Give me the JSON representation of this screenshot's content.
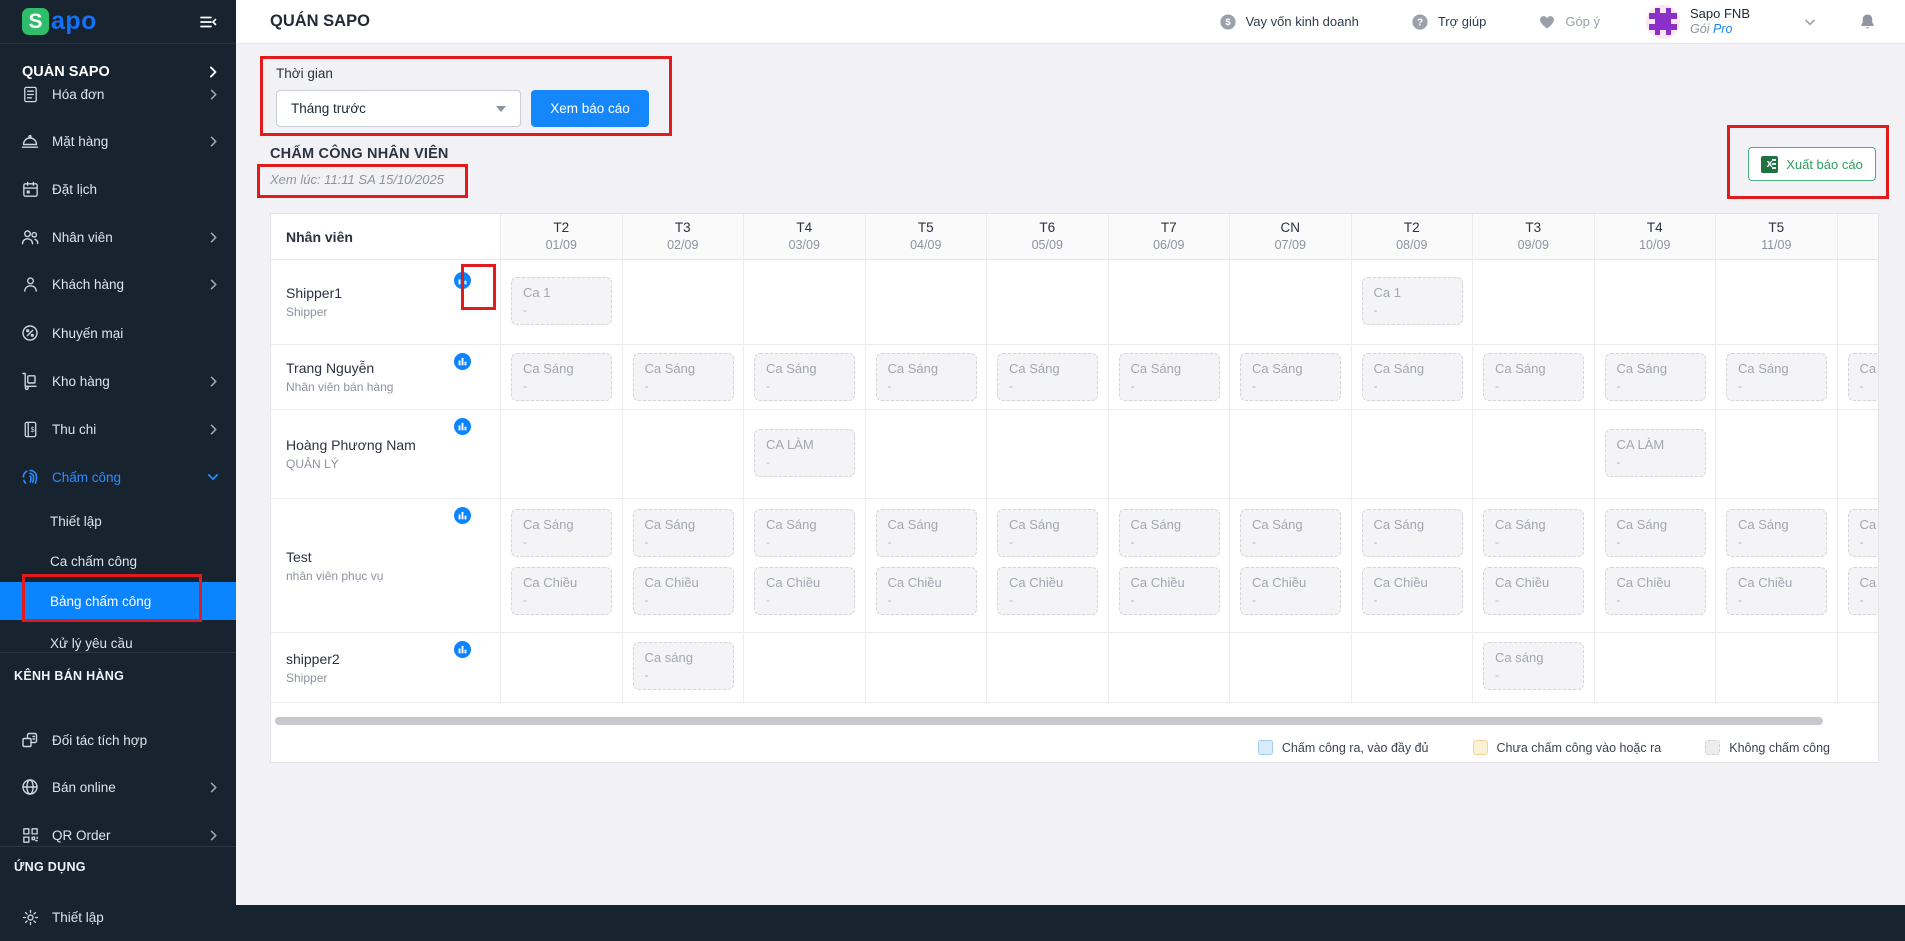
{
  "brand": {
    "logo_s": "S",
    "logo_rest": "apo",
    "colors": {
      "accent_blue": "#1687fa",
      "active_nav_blue": "#0b84ff",
      "logo_green": "#2ebd6b",
      "logo_blue": "#1470f5",
      "annotation_red": "#e11b1b",
      "export_green": "#2f9e5f"
    }
  },
  "topbar": {
    "title": "QUÁN SAPO",
    "links": [
      {
        "icon": "dollar-circle-icon",
        "label": "Vay vốn kinh doanh",
        "muted": false
      },
      {
        "icon": "question-circle-icon",
        "label": "Trợ giúp",
        "muted": false
      },
      {
        "icon": "heart-icon",
        "label": "Góp ý",
        "muted": true
      }
    ],
    "account": {
      "name": "Sapo FNB",
      "plan_label": "Gói",
      "plan_value": "Pro"
    }
  },
  "sidebar": {
    "store_label": "QUÁN SAPO",
    "sections": [
      {
        "header": "",
        "items": [
          {
            "label": "Hóa đơn",
            "icon": "invoice-icon",
            "chevron": "right"
          },
          {
            "label": "Mặt hàng",
            "icon": "dish-icon",
            "chevron": "right"
          },
          {
            "label": "Đặt lịch",
            "icon": "calendar-icon",
            "chevron": ""
          },
          {
            "label": "Nhân viên",
            "icon": "staff-icon",
            "chevron": "right"
          },
          {
            "label": "Khách hàng",
            "icon": "customer-icon",
            "chevron": "right"
          },
          {
            "label": "Khuyến mại",
            "icon": "promo-icon",
            "chevron": ""
          },
          {
            "label": "Kho hàng",
            "icon": "warehouse-icon",
            "chevron": "right"
          },
          {
            "label": "Thu chi",
            "icon": "cashbook-icon",
            "chevron": "right"
          },
          {
            "label": "Chấm công",
            "icon": "fingerprint-icon",
            "chevron": "down",
            "active": true,
            "children": [
              {
                "label": "Thiết lập",
                "active": false
              },
              {
                "label": "Ca chấm công",
                "active": false
              },
              {
                "label": "Bảng chấm công",
                "active": true
              },
              {
                "label": "Xử lý yêu cầu",
                "active": false
              }
            ]
          }
        ]
      },
      {
        "header": "KÊNH BÁN HÀNG",
        "items": [
          {
            "label": "Đối tác tích hợp",
            "icon": "integration-icon",
            "chevron": ""
          },
          {
            "label": "Bán online",
            "icon": "globe-icon",
            "chevron": "right"
          },
          {
            "label": "QR Order",
            "icon": "qr-icon",
            "chevron": "right"
          }
        ]
      },
      {
        "header": "ỨNG DỤNG",
        "items": [
          {
            "label": "Thiết lập",
            "icon": "gear-icon",
            "chevron": ""
          }
        ]
      }
    ]
  },
  "filter": {
    "label": "Thời gian",
    "selected": "Tháng trước",
    "submit_label": "Xem báo cáo"
  },
  "report": {
    "title": "CHẤM CÔNG NHÂN VIÊN",
    "viewed_at": "Xem lúc: 11:11 SA 15/10/2025",
    "export_label": "Xuất báo cáo"
  },
  "table": {
    "staff_header": "Nhân viên",
    "chip_value": "-",
    "columns": [
      {
        "day": "T2",
        "date": "01/09"
      },
      {
        "day": "T3",
        "date": "02/09"
      },
      {
        "day": "T4",
        "date": "03/09"
      },
      {
        "day": "T5",
        "date": "04/09"
      },
      {
        "day": "T6",
        "date": "05/09"
      },
      {
        "day": "T7",
        "date": "06/09"
      },
      {
        "day": "CN",
        "date": "07/09"
      },
      {
        "day": "T2",
        "date": "08/09"
      },
      {
        "day": "T3",
        "date": "09/09"
      },
      {
        "day": "T4",
        "date": "10/09"
      },
      {
        "day": "T5",
        "date": "11/09"
      },
      {
        "day": "",
        "date": ""
      }
    ],
    "rows": [
      {
        "name": "Shipper1",
        "role": "Shipper",
        "cells": {
          "0": [
            "Ca 1"
          ],
          "7": [
            "Ca 1"
          ]
        }
      },
      {
        "name": "Trang Nguyễn",
        "role": "Nhân viên bán hàng",
        "cells": {
          "0": [
            "Ca Sáng"
          ],
          "1": [
            "Ca Sáng"
          ],
          "2": [
            "Ca Sáng"
          ],
          "3": [
            "Ca Sáng"
          ],
          "4": [
            "Ca Sáng"
          ],
          "5": [
            "Ca Sáng"
          ],
          "6": [
            "Ca Sáng"
          ],
          "7": [
            "Ca Sáng"
          ],
          "8": [
            "Ca Sáng"
          ],
          "9": [
            "Ca Sáng"
          ],
          "10": [
            "Ca Sáng"
          ],
          "11": [
            "Ca Sáng"
          ]
        }
      },
      {
        "name": "Hoàng Phương Nam",
        "role": "QUẢN LÝ",
        "cells": {
          "2": [
            "CA LÀM"
          ],
          "9": [
            "CA LÀM"
          ]
        }
      },
      {
        "name": "Test",
        "role": "nhân viên phục vụ",
        "cells": {
          "0": [
            "Ca Sáng",
            "Ca Chiều"
          ],
          "1": [
            "Ca Sáng",
            "Ca Chiều"
          ],
          "2": [
            "Ca Sáng",
            "Ca Chiều"
          ],
          "3": [
            "Ca Sáng",
            "Ca Chiều"
          ],
          "4": [
            "Ca Sáng",
            "Ca Chiều"
          ],
          "5": [
            "Ca Sáng",
            "Ca Chiều"
          ],
          "6": [
            "Ca Sáng",
            "Ca Chiều"
          ],
          "7": [
            "Ca Sáng",
            "Ca Chiều"
          ],
          "8": [
            "Ca Sáng",
            "Ca Chiều"
          ],
          "9": [
            "Ca Sáng",
            "Ca Chiều"
          ],
          "10": [
            "Ca Sáng",
            "Ca Chiều"
          ],
          "11": [
            "Ca Sáng",
            "Ca Chiều"
          ]
        }
      },
      {
        "name": "shipper2",
        "role": "Shipper",
        "cells": {
          "1": [
            "Ca sáng"
          ],
          "8": [
            "Ca sáng"
          ]
        }
      }
    ]
  },
  "legend": [
    {
      "label": "Chấm công ra, vào đầy đủ",
      "fill": "#d9ecfb",
      "border": "#9fccf3",
      "border_style": "solid"
    },
    {
      "label": "Chưa chấm công vào hoặc ra",
      "fill": "#fcf1d4",
      "border": "#f0d694",
      "border_style": "solid"
    },
    {
      "label": "Không chấm công",
      "fill": "#ededf0",
      "border": "#cdced6",
      "border_style": "dashed"
    }
  ]
}
